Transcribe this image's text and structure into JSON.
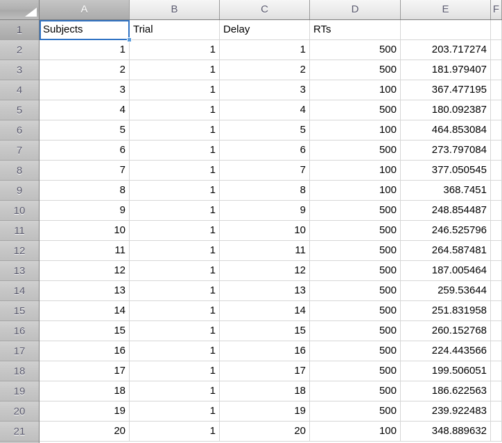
{
  "app": {
    "type": "spreadsheet",
    "corner_icon": "select-all-triangle-icon"
  },
  "grid": {
    "column_headers": [
      "A",
      "B",
      "C",
      "D",
      "E",
      "F"
    ],
    "active_column": "A",
    "active_row": "1",
    "row_headers": [
      "1",
      "2",
      "3",
      "4",
      "5",
      "6",
      "7",
      "8",
      "9",
      "10",
      "11",
      "12",
      "13",
      "14",
      "15",
      "16",
      "17",
      "18",
      "19",
      "20",
      "21"
    ],
    "selected_cell": "A1",
    "selected_cell_value": "Subjects"
  },
  "colors": {
    "selection_border": "#2f72c4",
    "fill_handle": "#5a9bdc",
    "gridline": "#d6d6d6",
    "header_text": "#5a5a6e",
    "row_header_bg": "#c9c9c9",
    "cell_bg": "#ffffff"
  },
  "table": {
    "headers": {
      "A": "Subjects",
      "B": "Trial",
      "C": "Delay",
      "D": "RTs",
      "E": ""
    },
    "rows": [
      {
        "row": "2",
        "A": "1",
        "B": "1",
        "C": "1",
        "D": "500",
        "E": "203.717274"
      },
      {
        "row": "3",
        "A": "2",
        "B": "1",
        "C": "2",
        "D": "500",
        "E": "181.979407"
      },
      {
        "row": "4",
        "A": "3",
        "B": "1",
        "C": "3",
        "D": "100",
        "E": "367.477195"
      },
      {
        "row": "5",
        "A": "4",
        "B": "1",
        "C": "4",
        "D": "500",
        "E": "180.092387"
      },
      {
        "row": "6",
        "A": "5",
        "B": "1",
        "C": "5",
        "D": "100",
        "E": "464.853084"
      },
      {
        "row": "7",
        "A": "6",
        "B": "1",
        "C": "6",
        "D": "500",
        "E": "273.797084"
      },
      {
        "row": "8",
        "A": "7",
        "B": "1",
        "C": "7",
        "D": "100",
        "E": "377.050545"
      },
      {
        "row": "9",
        "A": "8",
        "B": "1",
        "C": "8",
        "D": "100",
        "E": "368.7451"
      },
      {
        "row": "10",
        "A": "9",
        "B": "1",
        "C": "9",
        "D": "500",
        "E": "248.854487"
      },
      {
        "row": "11",
        "A": "10",
        "B": "1",
        "C": "10",
        "D": "500",
        "E": "246.525796"
      },
      {
        "row": "12",
        "A": "11",
        "B": "1",
        "C": "11",
        "D": "500",
        "E": "264.587481"
      },
      {
        "row": "13",
        "A": "12",
        "B": "1",
        "C": "12",
        "D": "500",
        "E": "187.005464"
      },
      {
        "row": "14",
        "A": "13",
        "B": "1",
        "C": "13",
        "D": "500",
        "E": "259.53644"
      },
      {
        "row": "15",
        "A": "14",
        "B": "1",
        "C": "14",
        "D": "500",
        "E": "251.831958"
      },
      {
        "row": "16",
        "A": "15",
        "B": "1",
        "C": "15",
        "D": "500",
        "E": "260.152768"
      },
      {
        "row": "17",
        "A": "16",
        "B": "1",
        "C": "16",
        "D": "500",
        "E": "224.443566"
      },
      {
        "row": "18",
        "A": "17",
        "B": "1",
        "C": "17",
        "D": "500",
        "E": "199.506051"
      },
      {
        "row": "19",
        "A": "18",
        "B": "1",
        "C": "18",
        "D": "500",
        "E": "186.622563"
      },
      {
        "row": "20",
        "A": "19",
        "B": "1",
        "C": "19",
        "D": "500",
        "E": "239.922483"
      },
      {
        "row": "21",
        "A": "20",
        "B": "1",
        "C": "20",
        "D": "100",
        "E": "348.889632"
      }
    ]
  }
}
